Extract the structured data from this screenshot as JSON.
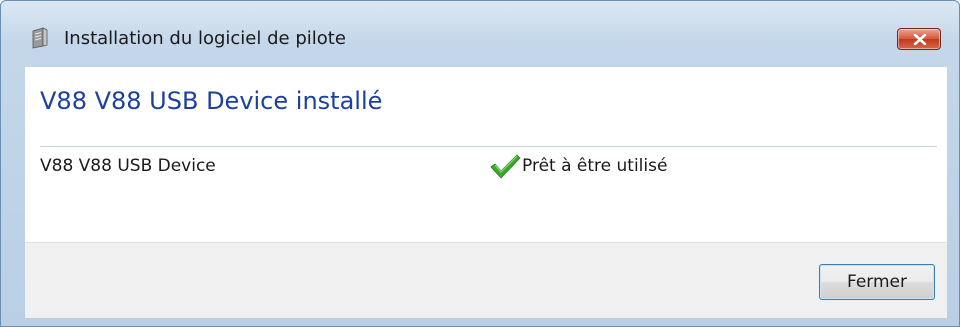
{
  "window": {
    "title": "Installation du logiciel de pilote",
    "icon": "driver-software-icon"
  },
  "main": {
    "heading": "V88 V88 USB Device installé",
    "devices": [
      {
        "name": "V88 V88 USB Device",
        "status": "Prêt à être utilisé",
        "status_icon": "green-checkmark-icon"
      }
    ]
  },
  "footer": {
    "close_label": "Fermer"
  },
  "colors": {
    "heading": "#1d3f9f",
    "check": "#3ea82e",
    "close_button": "#c9472b"
  }
}
